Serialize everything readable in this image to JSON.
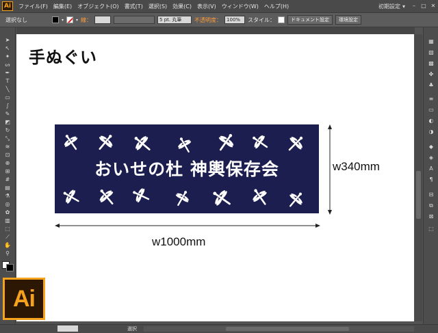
{
  "app": {
    "logo": "Ai",
    "big_logo": "Ai",
    "workspace": "初期設定"
  },
  "menu": [
    "ファイル(F)",
    "編集(E)",
    "オブジェクト(O)",
    "書式(T)",
    "選択(S)",
    "効果(C)",
    "表示(V)",
    "ウィンドウ(W)",
    "ヘルプ(H)"
  ],
  "control": {
    "selection": "選択なし",
    "stroke_label": "線：",
    "brush": "5 pt. 丸筆",
    "opacity_label": "不透明度：",
    "opacity_value": "100%",
    "style_label": "スタイル：",
    "doc_setup": "ドキュメント設定",
    "prefs": "環境設定"
  },
  "artwork": {
    "title": "手ぬぐい",
    "banner_text": "おいせの杜 神輿保存会",
    "width_label": "w1000mm",
    "height_label": "w340mm",
    "banner_color": "#1c1e4f"
  },
  "status": {
    "zoom": "",
    "mode": "選択"
  },
  "colors": {
    "app_bg": "#535353",
    "accent": "#f7a21c",
    "warning": "#ff9c3b"
  }
}
